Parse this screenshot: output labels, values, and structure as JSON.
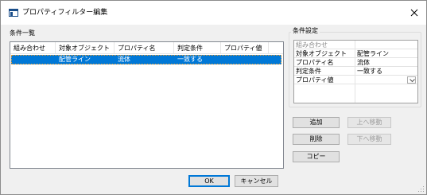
{
  "window": {
    "title": "プロパティフィルター編集"
  },
  "list_panel": {
    "label": "条件一覧",
    "columns": [
      "組み合わせ",
      "対象オブジェクト",
      "プロパティ名",
      "判定条件",
      "プロパティ値"
    ],
    "rows": [
      {
        "combination": "",
        "target_object": "配管ライン",
        "property_name": "流体",
        "condition": "一致する",
        "property_value": ""
      }
    ]
  },
  "settings_panel": {
    "label": "条件設定",
    "fields": [
      {
        "key": "組み合わせ",
        "value": ""
      },
      {
        "key": "対象オブジェクト",
        "value": "配管ライン"
      },
      {
        "key": "プロパティ名",
        "value": "流体"
      },
      {
        "key": "判定条件",
        "value": "一致する"
      },
      {
        "key": "プロパティ値",
        "value": ""
      }
    ]
  },
  "actions": {
    "add": "追加",
    "move_up": "上へ移動",
    "delete": "削除",
    "move_down": "下へ移動",
    "copy": "コピー"
  },
  "footer": {
    "ok": "OK",
    "cancel": "キャンセル"
  },
  "colors": {
    "selection": "#0078d7",
    "title_icon": "#1a4e8a"
  }
}
